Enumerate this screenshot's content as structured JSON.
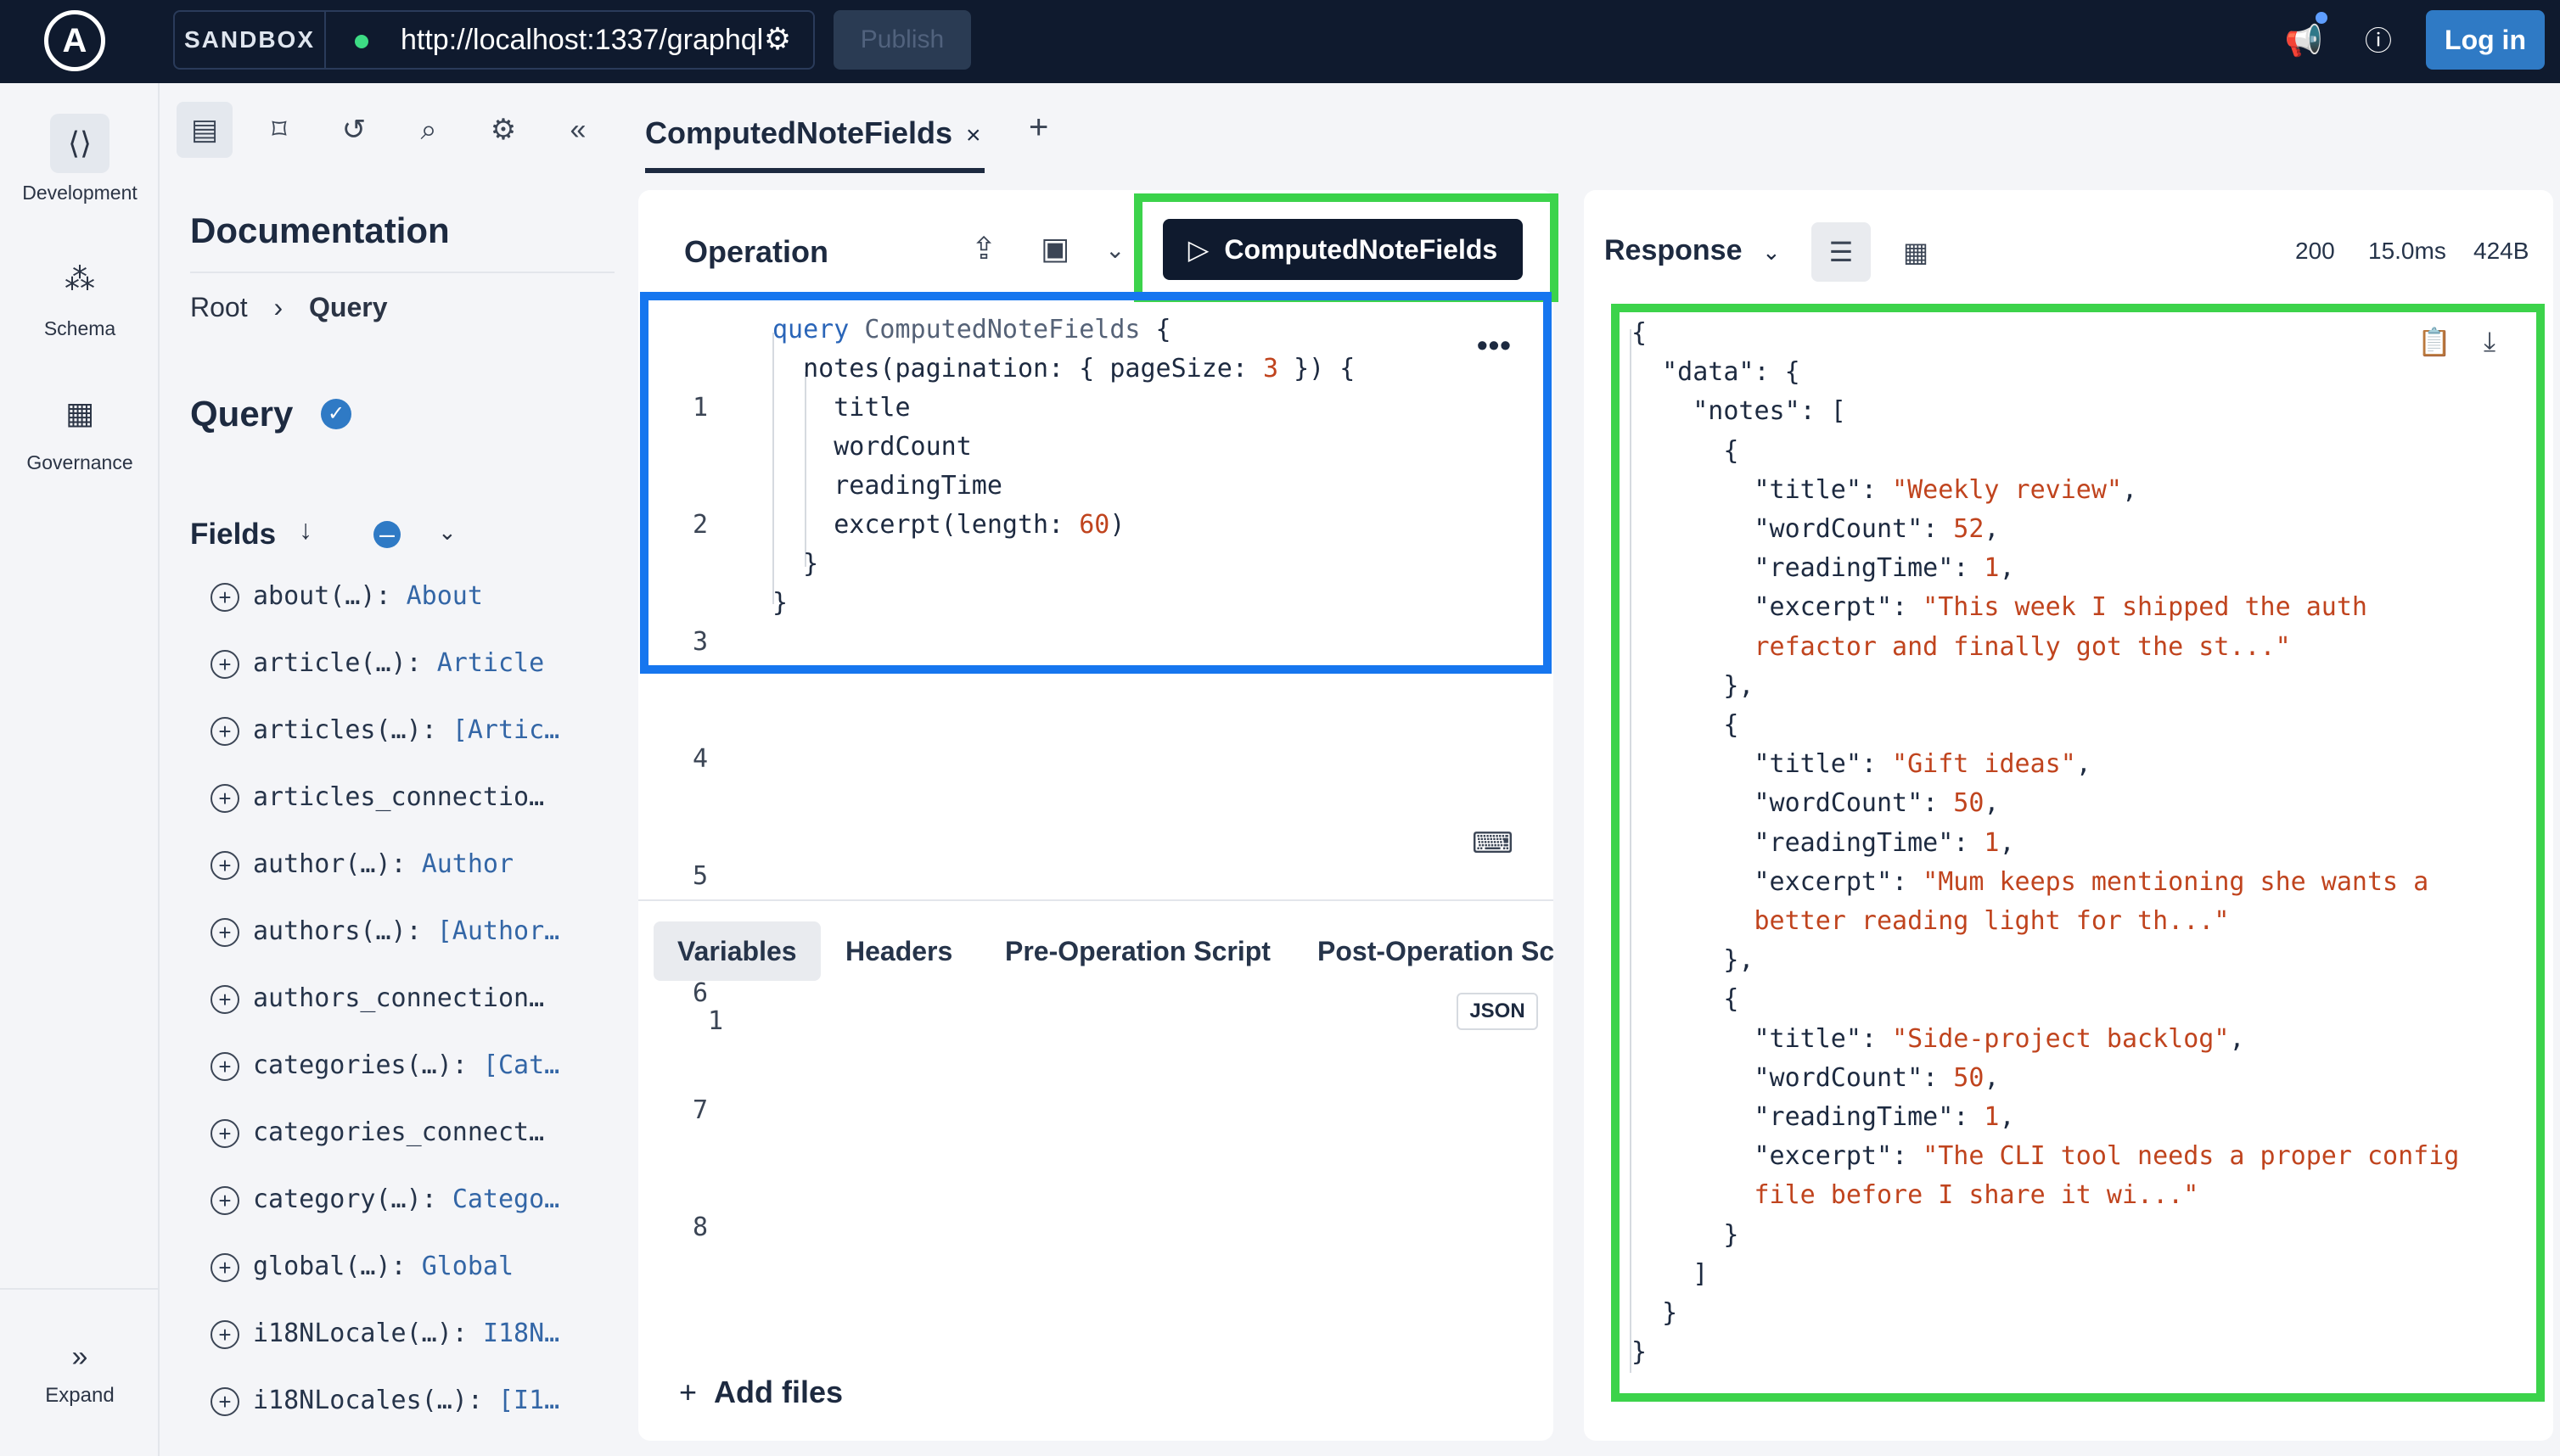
{
  "topbar": {
    "logo": "A",
    "sandbox_label": "SANDBOX",
    "url": "http://localhost:1337/graphql",
    "publish_label": "Publish",
    "login_label": "Log in",
    "icons": [
      "settings-gear-icon",
      "megaphone-icon",
      "help-icon"
    ]
  },
  "leftnav": {
    "items": [
      {
        "label": "Development",
        "icon": "code-doc-icon"
      },
      {
        "label": "Schema",
        "icon": "schema-graph-icon"
      },
      {
        "label": "Governance",
        "icon": "building-icon"
      }
    ],
    "expand_label": "Expand"
  },
  "docs": {
    "title": "Documentation",
    "breadcrumb_root": "Root",
    "breadcrumb_current": "Query",
    "type_title": "Query",
    "fields_label": "Fields",
    "fields": [
      {
        "name": "about(…): ",
        "type": "About"
      },
      {
        "name": "article(…): ",
        "type": "Article"
      },
      {
        "name": "articles(…): ",
        "type": "[Artic…"
      },
      {
        "name": "articles_connectio…",
        "type": ""
      },
      {
        "name": "author(…): ",
        "type": "Author"
      },
      {
        "name": "authors(…): ",
        "type": "[Author…"
      },
      {
        "name": "authors_connection…",
        "type": ""
      },
      {
        "name": "categories(…): ",
        "type": "[Cat…"
      },
      {
        "name": "categories_connect…",
        "type": ""
      },
      {
        "name": "category(…): ",
        "type": "Catego…"
      },
      {
        "name": "global(…): ",
        "type": "Global"
      },
      {
        "name": "i18NLocale(…): ",
        "type": "I18N…"
      },
      {
        "name": "i18NLocales(…): ",
        "type": "[I1…"
      }
    ]
  },
  "tab": {
    "label": "ComputedNoteFields",
    "close": "×",
    "add": "+"
  },
  "operation": {
    "title": "Operation",
    "run_label": "ComputedNoteFields",
    "line_numbers": [
      "1",
      "2",
      "3",
      "4",
      "5",
      "6",
      "7",
      "8"
    ],
    "code": {
      "l1_kw": "query",
      "l1_name": " ComputedNoteFields",
      "l1_rest": " {",
      "l2_a": "  notes(pagination: { pageSize: ",
      "l2_num": "3",
      "l2_b": " }) {",
      "l3": "    title",
      "l4": "    wordCount",
      "l5": "    readingTime",
      "l6_a": "    excerpt(length: ",
      "l6_num": "60",
      "l6_b": ")",
      "l7": "  }",
      "l8": "}"
    },
    "subtabs": [
      "Variables",
      "Headers",
      "Pre-Operation Script",
      "Post-Operation Sc"
    ],
    "json_label": "JSON",
    "var_line": "1",
    "add_files": "Add files"
  },
  "response": {
    "title": "Response",
    "status": "200",
    "time": "15.0ms",
    "size": "424B",
    "lines": [
      {
        "t": "{",
        "s": ""
      },
      {
        "t": "  \"data\": {",
        "s": ""
      },
      {
        "t": "    \"notes\": [",
        "s": ""
      },
      {
        "t": "      {",
        "s": ""
      },
      {
        "t": "        \"title\": ",
        "s": "\"Weekly review\"",
        "e": ","
      },
      {
        "t": "        \"wordCount\": ",
        "s": "52",
        "e": ","
      },
      {
        "t": "        \"readingTime\": ",
        "s": "1",
        "e": ","
      },
      {
        "t": "        \"excerpt\": ",
        "s": "\"This week I shipped the auth",
        "e": ""
      },
      {
        "t": "        ",
        "s": "refactor and finally got the st...\"",
        "e": ""
      },
      {
        "t": "      },",
        "s": ""
      },
      {
        "t": "      {",
        "s": ""
      },
      {
        "t": "        \"title\": ",
        "s": "\"Gift ideas\"",
        "e": ","
      },
      {
        "t": "        \"wordCount\": ",
        "s": "50",
        "e": ","
      },
      {
        "t": "        \"readingTime\": ",
        "s": "1",
        "e": ","
      },
      {
        "t": "        \"excerpt\": ",
        "s": "\"Mum keeps mentioning she wants a",
        "e": ""
      },
      {
        "t": "        ",
        "s": "better reading light for th...\"",
        "e": ""
      },
      {
        "t": "      },",
        "s": ""
      },
      {
        "t": "      {",
        "s": ""
      },
      {
        "t": "        \"title\": ",
        "s": "\"Side-project backlog\"",
        "e": ","
      },
      {
        "t": "        \"wordCount\": ",
        "s": "50",
        "e": ","
      },
      {
        "t": "        \"readingTime\": ",
        "s": "1",
        "e": ","
      },
      {
        "t": "        \"excerpt\": ",
        "s": "\"The CLI tool needs a proper config",
        "e": ""
      },
      {
        "t": "        ",
        "s": "file before I share it wi...\"",
        "e": ""
      },
      {
        "t": "      }",
        "s": ""
      },
      {
        "t": "    ]",
        "s": ""
      },
      {
        "t": "  }",
        "s": ""
      },
      {
        "t": "}",
        "s": ""
      }
    ]
  },
  "colors": {
    "highlight_green": "#3cd34b",
    "highlight_blue": "#1676ef",
    "topbar_bg": "#0f1a2e",
    "string_value": "#c0441e"
  }
}
